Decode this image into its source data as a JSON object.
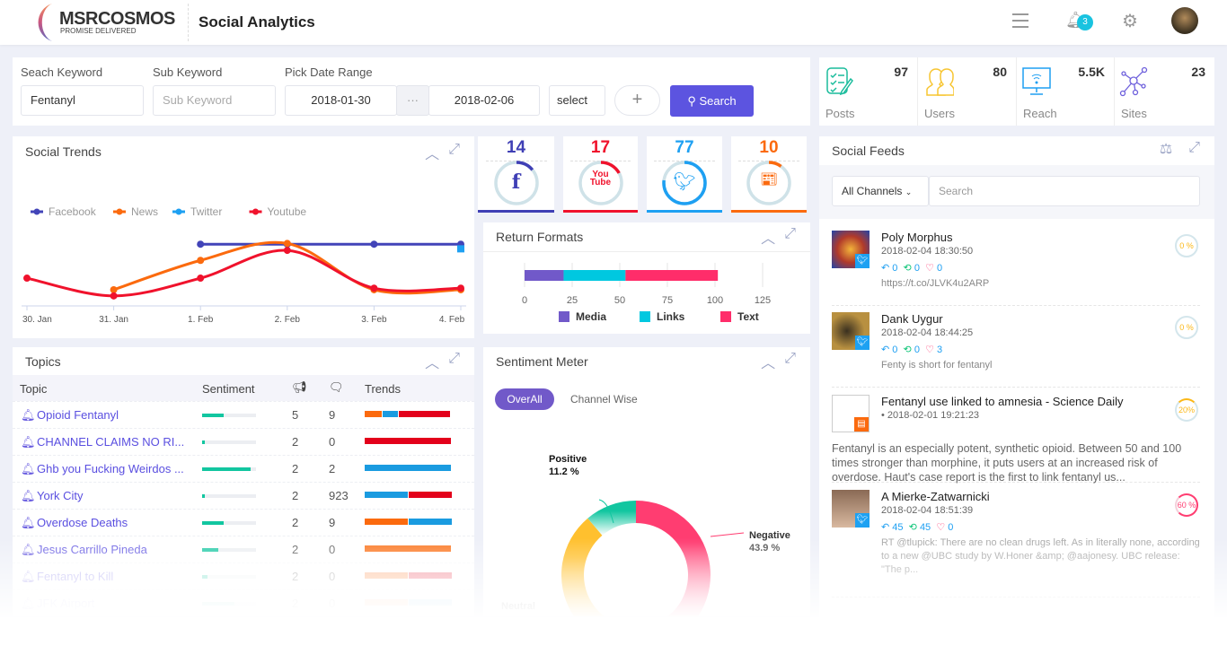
{
  "header": {
    "brand": "MSRCOSMOS",
    "tagline": "PROMISE DELIVERED",
    "title": "Social Analytics",
    "notification_count": "3"
  },
  "search": {
    "keyword_label": "Seach Keyword",
    "keyword_value": "Fentanyl",
    "sub_label": "Sub Keyword",
    "sub_placeholder": "Sub Keyword",
    "date_label": "Pick Date Range",
    "date_from": "2018-01-30",
    "date_sep": "···",
    "date_to": "2018-02-06",
    "select_value": "select",
    "add_label": "+",
    "search_label": "Search"
  },
  "stats": [
    {
      "label": "Posts",
      "value": "97",
      "icon": "checklist-icon",
      "color": "#1abc9c"
    },
    {
      "label": "Users",
      "value": "80",
      "icon": "users-icon",
      "color": "#f7c531"
    },
    {
      "label": "Reach",
      "value": "5.5K",
      "icon": "monitor-wifi-icon",
      "color": "#1e9ff2"
    },
    {
      "label": "Sites",
      "value": "23",
      "icon": "network-icon",
      "color": "#6d5fdc"
    }
  ],
  "channels": [
    {
      "name": "facebook",
      "value": "14",
      "pct": 14,
      "color": "#3f3fb5"
    },
    {
      "name": "youtube",
      "value": "17",
      "pct": 17,
      "color": "#f0122c"
    },
    {
      "name": "twitter",
      "value": "77",
      "pct": 77,
      "color": "#1ea0f2"
    },
    {
      "name": "news",
      "value": "10",
      "pct": 10,
      "color": "#fb6a0e"
    }
  ],
  "social_trends": {
    "title": "Social Trends"
  },
  "chart_data": [
    {
      "type": "line",
      "categories": [
        "30. Jan",
        "31. Jan",
        "1. Feb",
        "2. Feb",
        "3. Feb",
        "4. Feb"
      ],
      "series": [
        {
          "name": "Facebook",
          "color": "#4244b8",
          "values": [
            null,
            null,
            8,
            8,
            8,
            8
          ]
        },
        {
          "name": "News",
          "color": "#fb6a0e",
          "values": [
            null,
            2.1,
            5.9,
            8.1,
            2.1,
            2.1
          ]
        },
        {
          "name": "Twitter",
          "color": "#1ea0f2",
          "values": [
            null,
            null,
            null,
            null,
            null,
            7.4
          ]
        },
        {
          "name": "Youtube",
          "color": "#f0122c",
          "values": [
            3.6,
            1.3,
            3.6,
            7.2,
            2.3,
            2.3
          ]
        }
      ],
      "legend": "top-left",
      "grid": false
    },
    {
      "type": "bar",
      "title": "Return Formats",
      "stacked": true,
      "orientation": "horizontal",
      "xticks": [
        0,
        25,
        50,
        75,
        100,
        125
      ],
      "xlim": [
        0,
        125
      ],
      "series": [
        {
          "name": "Media",
          "color": "#7159c9",
          "value": 20.5
        },
        {
          "name": "Links",
          "color": "#00c8e0",
          "value": 32.5
        },
        {
          "name": "Text",
          "color": "#ff2d6a",
          "value": 48.5
        }
      ]
    },
    {
      "type": "pie",
      "title": "Sentiment Meter",
      "donut": true,
      "slices": [
        {
          "label": "Negative",
          "value": 43.9,
          "display": "43.9 %",
          "color": "#ff3d71"
        },
        {
          "label": "Neutral",
          "value": 44.9,
          "color": "#ffc02e"
        },
        {
          "label": "Positive",
          "value": 11.2,
          "display": "11.2 %",
          "color": "#12c6a0"
        }
      ]
    }
  ],
  "topics": {
    "title": "Topics",
    "columns": [
      "Topic",
      "Sentiment",
      "",
      "",
      "Trends"
    ],
    "rows": [
      {
        "name": "Opioid Fentanyl",
        "sentiment": 0.4,
        "posts": "5",
        "comments": "9",
        "trend": [
          [
            "#fb6a0e",
            0.2
          ],
          [
            "#1a9be0",
            0.17
          ],
          [
            "#e3001b",
            0.6
          ]
        ]
      },
      {
        "name": "CHANNEL CLAIMS NO RI...",
        "sentiment": 0.05,
        "posts": "2",
        "comments": "0",
        "trend": [
          [
            "#e3001b",
            1
          ]
        ]
      },
      {
        "name": "Ghb you Fucking Weirdos ...",
        "sentiment": 0.9,
        "posts": "2",
        "comments": "2",
        "trend": [
          [
            "#1a9be0",
            1
          ]
        ]
      },
      {
        "name": "York City",
        "sentiment": 0.05,
        "posts": "2",
        "comments": "923",
        "trend": [
          [
            "#1a9be0",
            0.5
          ],
          [
            "#e3001b",
            0.5
          ]
        ]
      },
      {
        "name": "Overdose Deaths",
        "sentiment": 0.4,
        "posts": "2",
        "comments": "9",
        "trend": [
          [
            "#fb6a0e",
            0.5
          ],
          [
            "#1a9be0",
            0.5
          ]
        ]
      },
      {
        "name": "Jesus Carrillo Pineda",
        "sentiment": 0.3,
        "posts": "2",
        "comments": "0",
        "trend": [
          [
            "#fb6a0e",
            1
          ]
        ]
      },
      {
        "name": "Fentanyl to Kill",
        "sentiment": 0.1,
        "posts": "2",
        "comments": "0",
        "trend": [
          [
            "#fb6a0e",
            0.5
          ],
          [
            "#e3001b",
            0.5
          ]
        ]
      },
      {
        "name": "JFK Airport",
        "sentiment": 0.6,
        "posts": "2",
        "comments": "0",
        "trend": [
          [
            "#fb6a0e",
            0.5
          ],
          [
            "#1a9be0",
            0.5
          ]
        ]
      }
    ]
  },
  "return_formats": {
    "title": "Return Formats"
  },
  "sentiment": {
    "title": "Sentiment Meter",
    "tab_overall": "OverAll",
    "tab_channel": "Channel Wise",
    "neutral_label": "Neutral"
  },
  "feeds": {
    "title": "Social Feeds",
    "channel_select": "All Channels",
    "search_placeholder": "Search",
    "items": [
      {
        "name": "Poly Morphus",
        "date": "2018-02-04 18:30:50",
        "replies": "0",
        "retweets": "0",
        "likes": "0",
        "text": "https://t.co/JLVK4u2ARP",
        "pct": "0 %",
        "source": "twitter"
      },
      {
        "name": "Dank Uygur",
        "date": "2018-02-04 18:44:25",
        "replies": "0",
        "retweets": "0",
        "likes": "3",
        "text": "Fenty is short for fentanyl",
        "pct": "0 %",
        "source": "twitter"
      },
      {
        "name": "Fentanyl use linked to amnesia - Science Daily",
        "date": "•  2018-02-01 19:21:23",
        "text": "Fentanyl is an especially potent, synthetic opioid. Between 50 and 100 times stronger than morphine, it puts users at an increased risk of overdose. Haut's case report is the first to link fentanyl us...",
        "pct": "20%",
        "source": "news"
      },
      {
        "name": "A Mierke-Zatwarnicki",
        "date": "2018-02-04 18:51:39",
        "replies": "45",
        "retweets": "45",
        "likes": "0",
        "text": "RT @tlupick: There are no clean drugs left. As in literally none, according to a new @UBC study by W.Honer &amp; @aajonesy. UBC release: \"The p...",
        "pct": "60 %",
        "source": "twitter"
      }
    ]
  }
}
